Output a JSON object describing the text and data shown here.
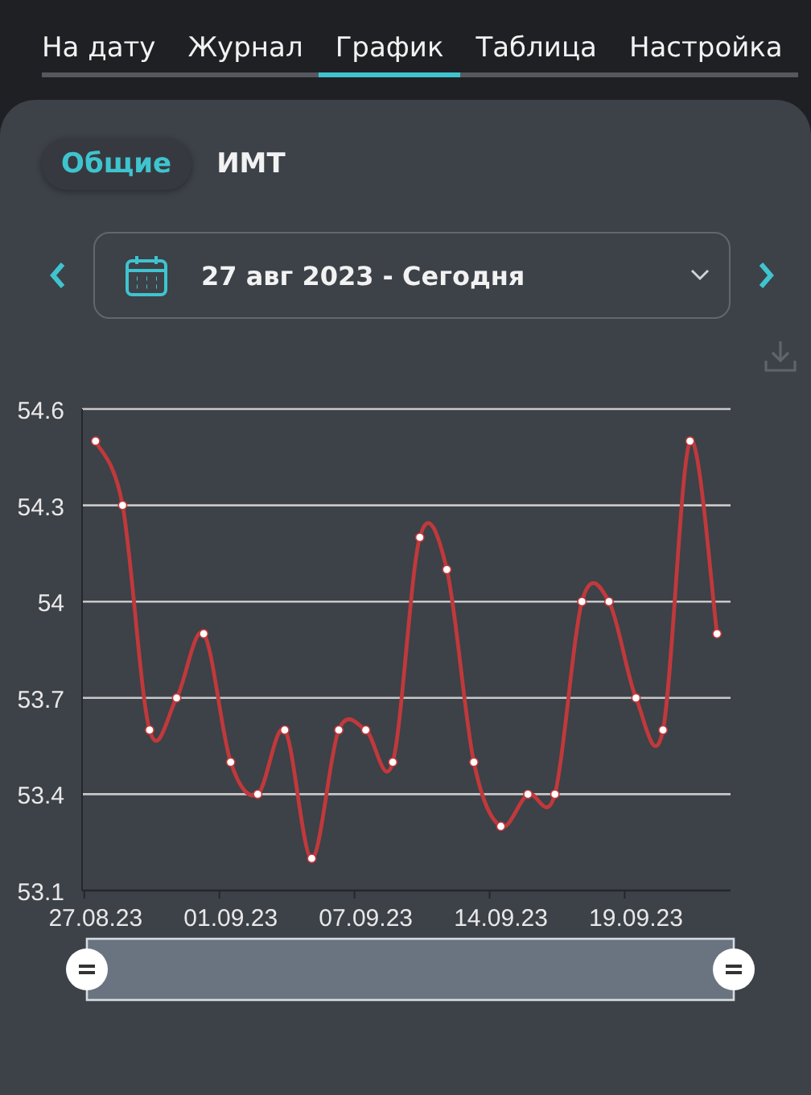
{
  "tabs": [
    {
      "label": "На дату",
      "selected": false
    },
    {
      "label": "Журнал",
      "selected": false
    },
    {
      "label": "График",
      "selected": true
    },
    {
      "label": "Таблица",
      "selected": false
    },
    {
      "label": "Настройка",
      "selected": false
    }
  ],
  "subtabs": [
    {
      "label": "Общие",
      "selected": true
    },
    {
      "label": "ИМТ",
      "selected": false
    }
  ],
  "date_range": {
    "value": "27 авг 2023 - Сегодня"
  },
  "chart": {
    "chart_data": {
      "type": "line",
      "categories": [
        "27.08.23",
        null,
        null,
        null,
        null,
        "01.09.23",
        null,
        null,
        null,
        null,
        "07.09.23",
        null,
        null,
        null,
        null,
        "14.09.23",
        null,
        null,
        null,
        null,
        "19.09.23",
        null,
        null,
        null
      ],
      "grid": true,
      "series": [
        {
          "color": "#c0393b",
          "marker": true,
          "values": [
            54.5,
            54.3,
            53.6,
            53.7,
            53.9,
            53.5,
            53.4,
            53.6,
            53.2,
            53.6,
            53.6,
            53.5,
            54.2,
            54.1,
            53.5,
            53.3,
            53.4,
            53.4,
            54.0,
            54.0,
            53.7,
            53.6,
            54.5,
            53.9
          ]
        }
      ],
      "ylim": [
        53.1,
        54.6
      ],
      "yticks": [
        {
          "value": 53.1,
          "label": "53.1"
        },
        {
          "value": 53.4,
          "label": "53.4"
        },
        {
          "value": 53.7,
          "label": "53.7"
        },
        {
          "value": 54.0,
          "label": "54"
        },
        {
          "value": 54.3,
          "label": "54.3"
        },
        {
          "value": 54.6,
          "label": "54.6"
        }
      ]
    }
  }
}
